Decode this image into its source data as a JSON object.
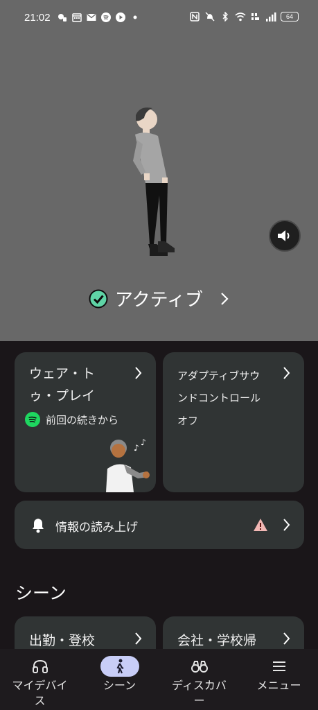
{
  "status_bar": {
    "time": "21:02",
    "battery": "64",
    "left_icons": [
      "app-icon",
      "calendar-icon",
      "mail-icon",
      "spotify-icon",
      "media-icon",
      "dot-icon"
    ],
    "right_icons": [
      "nfc-icon",
      "mute-icon",
      "bluetooth-icon",
      "wifi-icon",
      "volte-icon",
      "signal-icon",
      "battery-icon"
    ]
  },
  "hero": {
    "mode_label": "アクティブ",
    "check_color": "#5fd4a6",
    "background": "#686868"
  },
  "cards": {
    "wear_to_play": {
      "title_line1": "ウェア・ト",
      "title_line2": "ゥ・プレイ",
      "subtitle": "前回の続きから"
    },
    "adaptive_sound": {
      "title_line1": "アダプティブサウ",
      "title_line2": "ンドコントロール",
      "value": "オフ"
    },
    "read_aloud": {
      "title": "情報の読み上げ",
      "warning_color": "#f2b8b5"
    }
  },
  "scenes": {
    "heading": "シーン",
    "items": [
      {
        "label": "出勤・登校"
      },
      {
        "label": "会社・学校帰"
      }
    ]
  },
  "bottom_nav": {
    "items": [
      {
        "label_line1": "マイデバイ",
        "label_line2": "ス",
        "icon": "headphones-icon"
      },
      {
        "label_line1": "シーン",
        "label_line2": "",
        "icon": "walk-icon",
        "active": true
      },
      {
        "label_line1": "ディスカバ",
        "label_line2": "ー",
        "icon": "binoculars-icon"
      },
      {
        "label_line1": "メニュー",
        "label_line2": "",
        "icon": "menu-icon"
      }
    ]
  }
}
